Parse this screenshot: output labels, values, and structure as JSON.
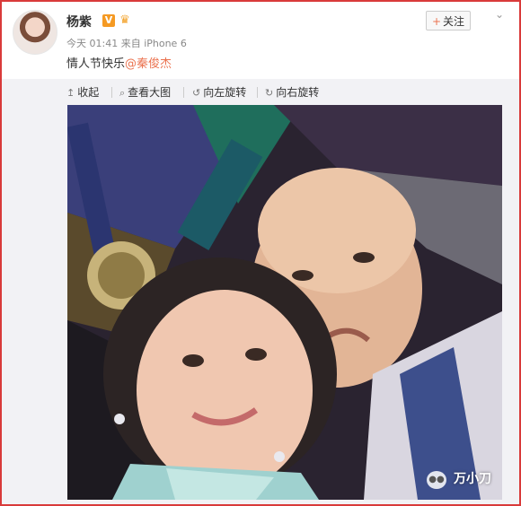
{
  "post": {
    "username": "杨紫",
    "verified_badge": "V",
    "verified_color": "#f59a23",
    "level_icon": "crown-icon",
    "meta": "今天 01:41 来自 iPhone 6",
    "content_text": "情人节快乐",
    "mention": "@秦俊杰",
    "mention_color": "#eb7350",
    "follow_plus": "+",
    "follow_label": "关注",
    "menu_icon": "chevron-down-icon"
  },
  "toolbar": {
    "collapse_icon": "↥",
    "collapse": "收起",
    "view_large_icon": "🔍",
    "view_large": "查看大图",
    "rotate_left_icon": "↺",
    "rotate_left": "向左旋转",
    "rotate_right_icon": "↻",
    "rotate_right": "向右旋转"
  },
  "photo": {
    "description_icon": "selfie-photo",
    "watermark_text": "万小刀",
    "watermark_icon": "wechat-icon"
  }
}
